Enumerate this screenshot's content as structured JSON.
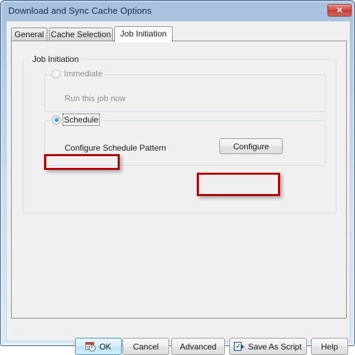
{
  "window": {
    "title": "Download and Sync Cache Options",
    "close_button_label": "✕",
    "close_icon_name": "close-icon"
  },
  "tabs": [
    {
      "id": "general",
      "label": "General",
      "selected": false
    },
    {
      "id": "cache_selection",
      "label": "Cache Selection",
      "selected": false
    },
    {
      "id": "job_initiation",
      "label": "Job Initiation",
      "selected": true
    }
  ],
  "group": {
    "title": "Job Initiation",
    "immediate": {
      "radio_label": "Immediate",
      "checked": false,
      "enabled": false,
      "description": "Run this job now"
    },
    "schedule": {
      "radio_label": "Schedule",
      "checked": true,
      "enabled": true,
      "focused": true,
      "description": "Configure Schedule Pattern",
      "configure_button_label": "Configure"
    }
  },
  "annotations": {
    "color": "#b00000",
    "items": [
      {
        "name": "schedule-radio-highlight",
        "target": "Schedule"
      },
      {
        "name": "configure-button-highlight",
        "target": "Configure"
      }
    ]
  },
  "buttons": {
    "ok": "OK",
    "cancel": "Cancel",
    "advanced": "Advanced",
    "save_as_script": "Save As Script",
    "help": "Help"
  },
  "colors": {
    "titlebar_start": "#a7c0dc",
    "titlebar_end": "#dae8f5",
    "dialog_face": "#f0f0f0",
    "accent_blue": "#2a8fd4",
    "annotation_red": "#b00000",
    "close_red": "#c33c31",
    "disabled_text": "#8d8d8d"
  }
}
